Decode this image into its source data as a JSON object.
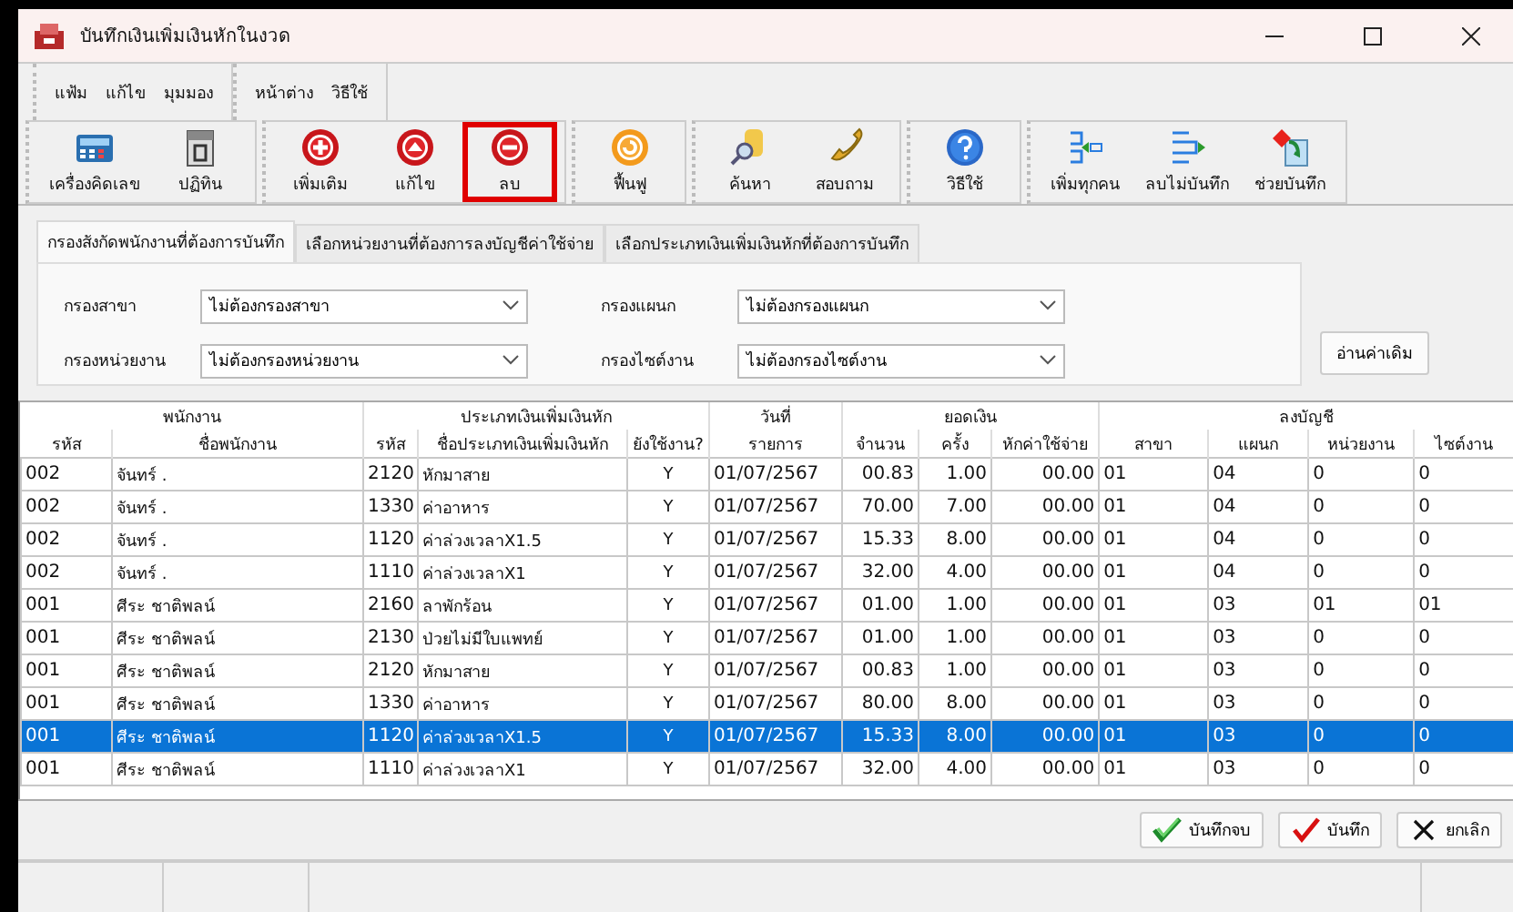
{
  "window": {
    "title": "บันทึกเงินเพิ่มเงินหักในงวด"
  },
  "menus": [
    [
      "แฟ้ม",
      "แก้ไข",
      "มุมมอง"
    ],
    [
      "หน้าต่าง",
      "วิธีใช้"
    ]
  ],
  "toolbar": [
    [
      {
        "label": "เครื่องคิดเลข",
        "highlighted": false
      },
      {
        "label": "ปฏิทิน",
        "highlighted": false
      }
    ],
    [
      {
        "label": "เพิ่มเติม",
        "highlighted": false
      },
      {
        "label": "แก้ไข",
        "highlighted": false
      },
      {
        "label": "ลบ",
        "highlighted": true
      }
    ],
    [
      {
        "label": "ฟื้นฟู",
        "highlighted": false
      }
    ],
    [
      {
        "label": "ค้นหา",
        "highlighted": false
      },
      {
        "label": "สอบถาม",
        "highlighted": false
      }
    ],
    [
      {
        "label": "วิธีใช้",
        "highlighted": false
      }
    ],
    [
      {
        "label": "เพิ่มทุกคน",
        "highlighted": false
      },
      {
        "label": "ลบไม่บันทึก",
        "highlighted": false
      },
      {
        "label": "ช่วยบันทึก",
        "highlighted": false
      }
    ]
  ],
  "tabs": [
    {
      "label": "กรองสังกัดพนักงานที่ต้องการบันทึก",
      "selected": true
    },
    {
      "label": "เลือกหน่วยงานที่ต้องการลงบัญชีค่าใช้จ่าย",
      "selected": false
    },
    {
      "label": "เลือกประเภทเงินเพิ่มเงินหักที่ต้องการบันทึก",
      "selected": false
    }
  ],
  "filters": [
    {
      "label": "กรองสาขา",
      "value": "ไม่ต้องกรองสาขา"
    },
    {
      "label": "กรองแผนก",
      "value": "ไม่ต้องกรองแผนก"
    },
    {
      "label": "กรองหน่วยงาน",
      "value": "ไม่ต้องกรองหน่วยงาน"
    },
    {
      "label": "กรองไซต์งาน",
      "value": "ไม่ต้องกรองไซต์งาน"
    }
  ],
  "read_button": "อ่านค่าเดิม",
  "table": {
    "groups": [
      "พนักงาน",
      "ประเภทเงินเพิ่มเงินหัก",
      "วันที่",
      "ยอดเงิน",
      "ลงบัญชี"
    ],
    "columns": [
      "รหัส",
      "ชื่อพนักงาน",
      "รหัส",
      "ชื่อประเภทเงินเพิ่มเงินหัก",
      "ยังใช้งาน?",
      "รายการ",
      "จำนวน",
      "ครั้ง",
      "หักค่าใช้จ่าย",
      "สาขา",
      "แผนก",
      "หน่วยงาน",
      "ไซต์งาน"
    ],
    "rows": [
      {
        "selected": false,
        "cells": [
          "002",
          "จันทร์  .",
          "2120",
          "หักมาสาย",
          "Y",
          "01/07/2567",
          "00.83",
          "1.00",
          "00.00",
          "01",
          "04",
          "0",
          "0"
        ]
      },
      {
        "selected": false,
        "cells": [
          "002",
          "จันทร์  .",
          "1330",
          "ค่าอาหาร",
          "Y",
          "01/07/2567",
          "70.00",
          "7.00",
          "00.00",
          "01",
          "04",
          "0",
          "0"
        ]
      },
      {
        "selected": false,
        "cells": [
          "002",
          "จันทร์  .",
          "1120",
          "ค่าล่วงเวลาX1.5",
          "Y",
          "01/07/2567",
          "15.33",
          "8.00",
          "00.00",
          "01",
          "04",
          "0",
          "0"
        ]
      },
      {
        "selected": false,
        "cells": [
          "002",
          "จันทร์  .",
          "1110",
          "ค่าล่วงเวลาX1",
          "Y",
          "01/07/2567",
          "32.00",
          "4.00",
          "00.00",
          "01",
          "04",
          "0",
          "0"
        ]
      },
      {
        "selected": false,
        "cells": [
          "001",
          "ศีระ  ชาติพลน์",
          "2160",
          "ลาพักร้อน",
          "Y",
          "01/07/2567",
          "01.00",
          "1.00",
          "00.00",
          "01",
          "03",
          "01",
          "01"
        ]
      },
      {
        "selected": false,
        "cells": [
          "001",
          "ศีระ  ชาติพลน์",
          "2130",
          "ป่วยไม่มีใบแพทย์",
          "Y",
          "01/07/2567",
          "01.00",
          "1.00",
          "00.00",
          "01",
          "03",
          "0",
          "0"
        ]
      },
      {
        "selected": false,
        "cells": [
          "001",
          "ศีระ  ชาติพลน์",
          "2120",
          "หักมาสาย",
          "Y",
          "01/07/2567",
          "00.83",
          "1.00",
          "00.00",
          "01",
          "03",
          "0",
          "0"
        ]
      },
      {
        "selected": false,
        "cells": [
          "001",
          "ศีระ  ชาติพลน์",
          "1330",
          "ค่าอาหาร",
          "Y",
          "01/07/2567",
          "80.00",
          "8.00",
          "00.00",
          "01",
          "03",
          "0",
          "0"
        ]
      },
      {
        "selected": true,
        "cells": [
          "001",
          "ศีระ  ชาติพลน์",
          "1120",
          "ค่าล่วงเวลาX1.5",
          "Y",
          "01/07/2567",
          "15.33",
          "8.00",
          "00.00",
          "01",
          "03",
          "0",
          "0"
        ]
      },
      {
        "selected": false,
        "cells": [
          "001",
          "ศีระ  ชาติพลน์",
          "1110",
          "ค่าล่วงเวลาX1",
          "Y",
          "01/07/2567",
          "32.00",
          "4.00",
          "00.00",
          "01",
          "03",
          "0",
          "0"
        ]
      }
    ]
  },
  "actions": [
    {
      "label": "บันทึกจบ",
      "kind": "save-close"
    },
    {
      "label": "บันทึก",
      "kind": "save"
    },
    {
      "label": "ยกเลิก",
      "kind": "cancel"
    }
  ]
}
